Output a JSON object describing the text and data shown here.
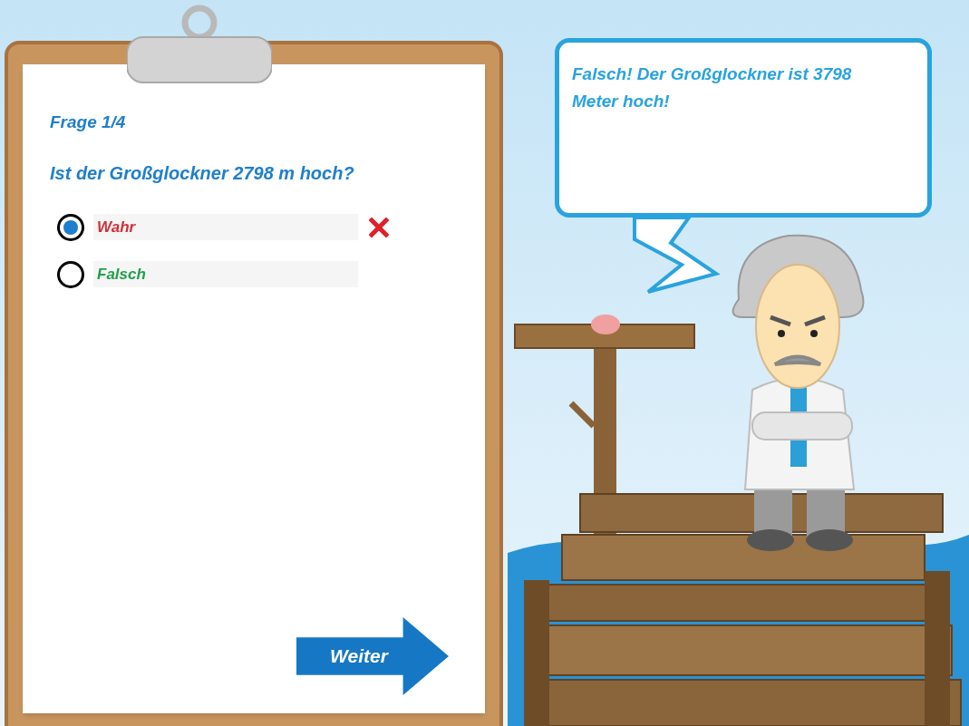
{
  "quiz": {
    "counter": "Frage 1/4",
    "question": "Ist der Großglockner 2798 m hoch?",
    "answers": [
      {
        "label": "Wahr",
        "selected": true,
        "correct": false
      },
      {
        "label": "Falsch",
        "selected": false,
        "correct": true
      }
    ],
    "next_button": "Weiter"
  },
  "speech_bubble": {
    "text": "Falsch! Der Großglockner ist 3798 Meter hoch!"
  }
}
